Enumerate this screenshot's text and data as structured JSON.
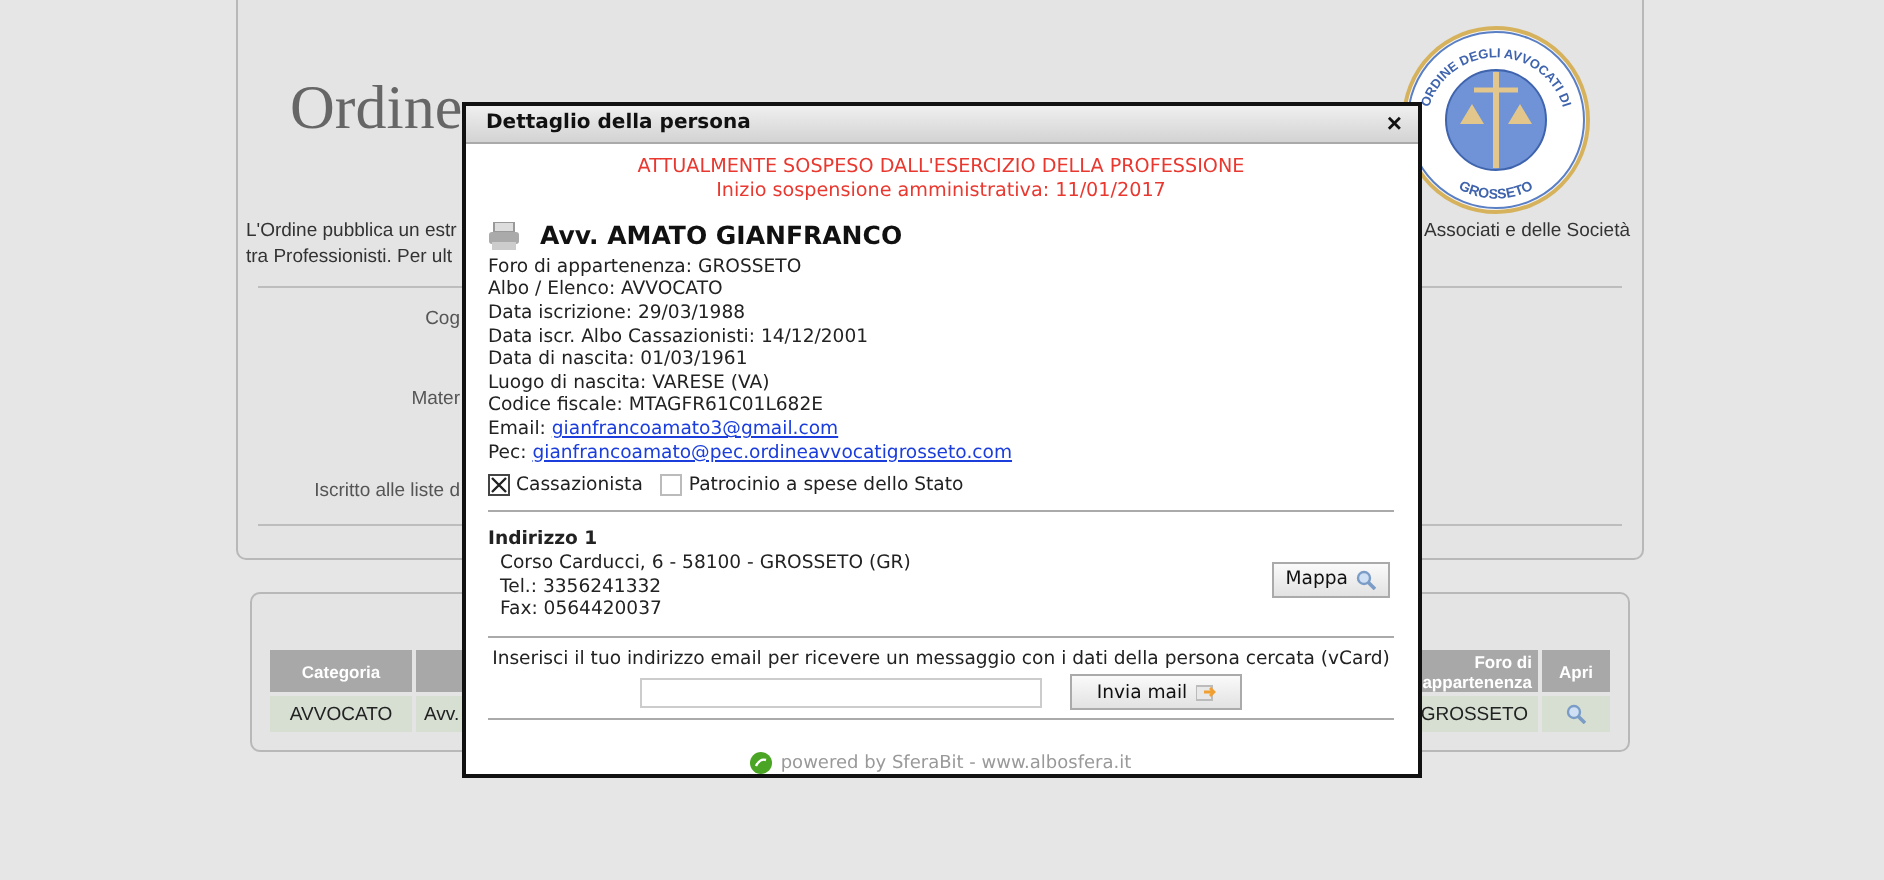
{
  "page": {
    "title": "Ordine",
    "intro_lines": [
      "L'Ordine pubblica un estr",
      "tra Professionisti. Per ult"
    ],
    "intro_right": "Associati e delle Società",
    "logo": {
      "top_text": "ORDINE DEGLI AVVOCATI DI",
      "bottom_text": "GROSSETO"
    },
    "form_labels": [
      "Cog",
      "Mater",
      "Iscritto alle liste d"
    ]
  },
  "results": {
    "columns_left": [
      "Categoria"
    ],
    "columns_right": [
      "Foro di appartenenza",
      "Apri"
    ],
    "rows": [
      {
        "categoria": "AVVOCATO",
        "column_2": "Avv.",
        "foro": "GROSSETO"
      }
    ]
  },
  "modal": {
    "title": "Dettaglio della persona",
    "close": "×",
    "notice": [
      "ATTUALMENTE SOSPESO DALL'ESERCIZIO DELLA PROFESSIONE",
      "Inizio sospensione amministrativa: 11/01/2017"
    ],
    "name": "Avv. AMATO GIANFRANCO",
    "fields": [
      {
        "kind": "text",
        "label": "Foro di appartenenza:",
        "value": "GROSSETO"
      },
      {
        "kind": "text",
        "label": "Albo / Elenco:",
        "value": "AVVOCATO"
      },
      {
        "kind": "text",
        "label": "Data iscrizione:",
        "value": "29/03/1988"
      },
      {
        "kind": "text",
        "label": "Data iscr. Albo Cassazionisti:",
        "value": "14/12/2001"
      },
      {
        "kind": "text",
        "label": "Data di nascita:",
        "value": "01/03/1961"
      },
      {
        "kind": "text",
        "label": "Luogo di nascita:",
        "value": "VARESE (VA)"
      },
      {
        "kind": "text",
        "label": "Codice fiscale:",
        "value": "MTAGFR61C01L682E"
      },
      {
        "kind": "link",
        "label": "Email:",
        "value": "gianfrancoamato3@gmail.com"
      },
      {
        "kind": "link",
        "label": "Pec:",
        "value": "gianfrancoamato@pec.ordineavvocatigrosseto.com"
      }
    ],
    "checkboxes": [
      {
        "label": "Cassazionista",
        "checked": true
      },
      {
        "label": "Patrocinio a spese dello Stato",
        "checked": false
      }
    ],
    "address": {
      "title": "Indirizzo 1",
      "lines": [
        "Corso Carducci, 6 - 58100 - GROSSETO (GR)",
        "Tel.: 3356241332",
        "Fax: 0564420037"
      ],
      "map_button": "Mappa"
    },
    "vcard": {
      "prompt": "Inserisci il tuo indirizzo email per ricevere un messaggio con i dati della persona cercata (vCard)",
      "button": "Invia mail"
    },
    "footer": "powered by SferaBit - www.albosfera.it"
  }
}
